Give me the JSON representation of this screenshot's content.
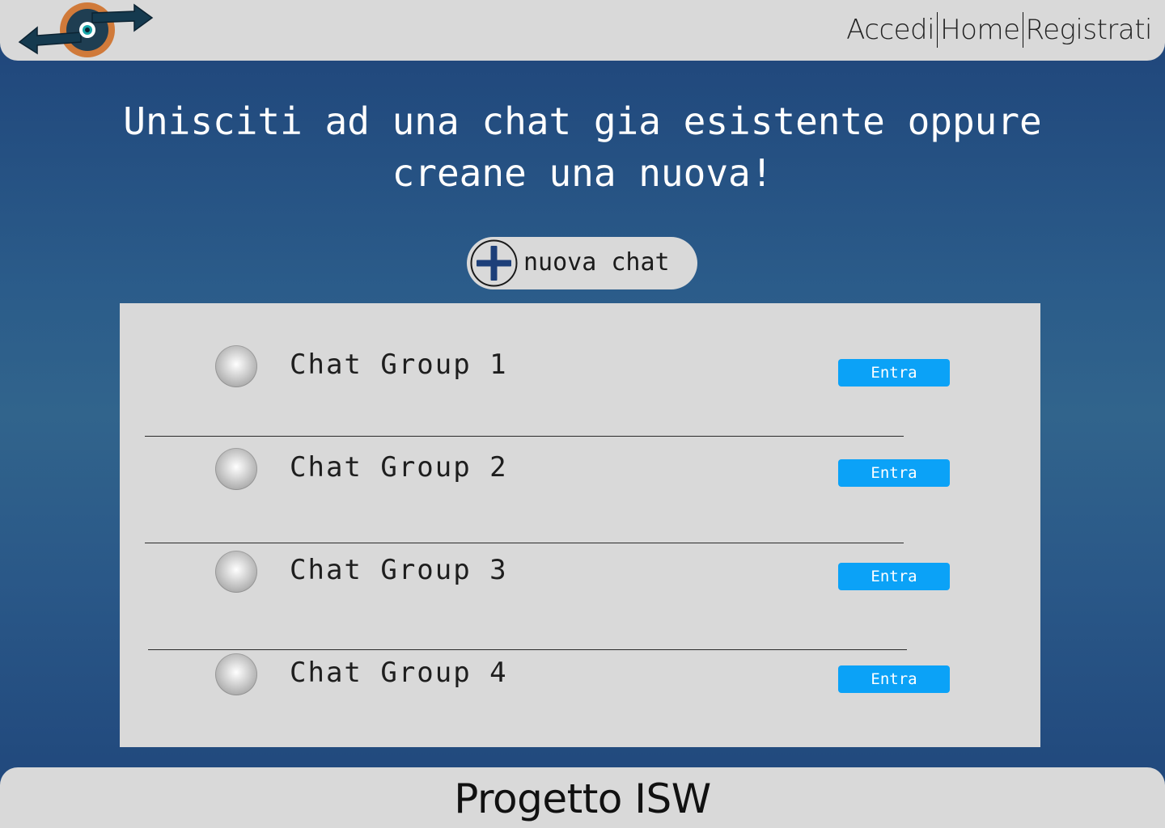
{
  "header": {
    "logo_icon": "link-chat-logo",
    "nav": {
      "login_label": "Accedi",
      "home_label": "Home",
      "register_label": "Registrati"
    }
  },
  "main": {
    "headline_line1": "Unisciti ad una chat gia esistente oppure",
    "headline_line2": "creane una nuova!",
    "new_chat": {
      "icon": "plus-circle-icon",
      "label": "nuova chat"
    }
  },
  "chat_list": {
    "items": [
      {
        "name": "Chat Group 1",
        "button_label": "Entra",
        "avatar_icon": "group-avatar-icon"
      },
      {
        "name": "Chat Group 2",
        "button_label": "Entra",
        "avatar_icon": "group-avatar-icon"
      },
      {
        "name": "Chat Group 3",
        "button_label": "Entra",
        "avatar_icon": "group-avatar-icon"
      },
      {
        "name": "Chat Group 4",
        "button_label": "Entra",
        "avatar_icon": "group-avatar-icon"
      }
    ]
  },
  "footer": {
    "title": "Progetto ISW"
  },
  "colors": {
    "panel_bg": "#d9d9d9",
    "enter_button": "#0ba2f7",
    "plus_icon": "#1d3f79",
    "background_top": "#1e4379",
    "background_mid": "#31648c"
  }
}
